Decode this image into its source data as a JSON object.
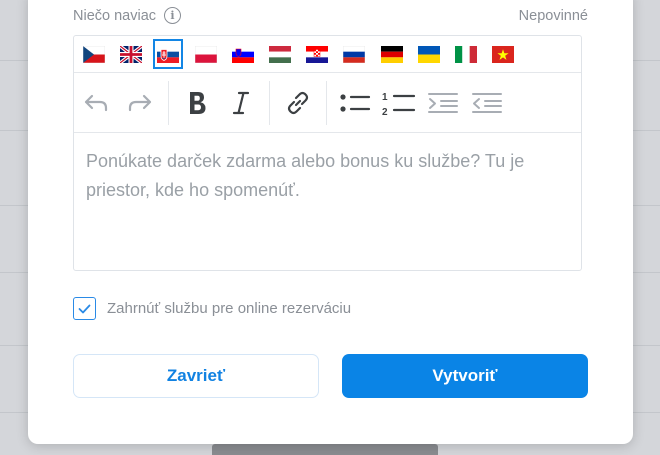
{
  "field": {
    "label": "Niečo naviac",
    "optional_text": "Nepovinné"
  },
  "editor": {
    "flags": [
      {
        "name": "czech-flag-icon",
        "code": "cs"
      },
      {
        "name": "uk-flag-icon",
        "code": "en"
      },
      {
        "name": "slovak-flag-icon",
        "code": "sk",
        "selected": true
      },
      {
        "name": "polish-flag-icon",
        "code": "pl"
      },
      {
        "name": "slovenian-flag-icon",
        "code": "sl"
      },
      {
        "name": "hungarian-flag-icon",
        "code": "hu"
      },
      {
        "name": "croatian-flag-icon",
        "code": "hr"
      },
      {
        "name": "russian-flag-icon",
        "code": "ru"
      },
      {
        "name": "german-flag-icon",
        "code": "de"
      },
      {
        "name": "ukrainian-flag-icon",
        "code": "uk"
      },
      {
        "name": "italian-flag-icon",
        "code": "it"
      },
      {
        "name": "vietnamese-flag-icon",
        "code": "vi"
      }
    ],
    "toolbar": [
      "undo-icon",
      "redo-icon",
      "bold-icon",
      "italic-icon",
      "link-icon",
      "bullet-list-icon",
      "numbered-list-icon",
      "indent-icon",
      "outdent-icon"
    ],
    "placeholder": "Ponúkate darček zdarma alebo bonus ku službe? Tu je priestor, kde ho spomenúť."
  },
  "checkbox": {
    "label": "Zahrnúť službu pre online rezerváciu",
    "checked": true
  },
  "buttons": {
    "close_label": "Zavrieť",
    "create_label": "Vytvoriť"
  },
  "colors": {
    "accent": "#0a84e6",
    "placeholder_text": "#9aa0a6",
    "label_text": "#8a8f96"
  }
}
